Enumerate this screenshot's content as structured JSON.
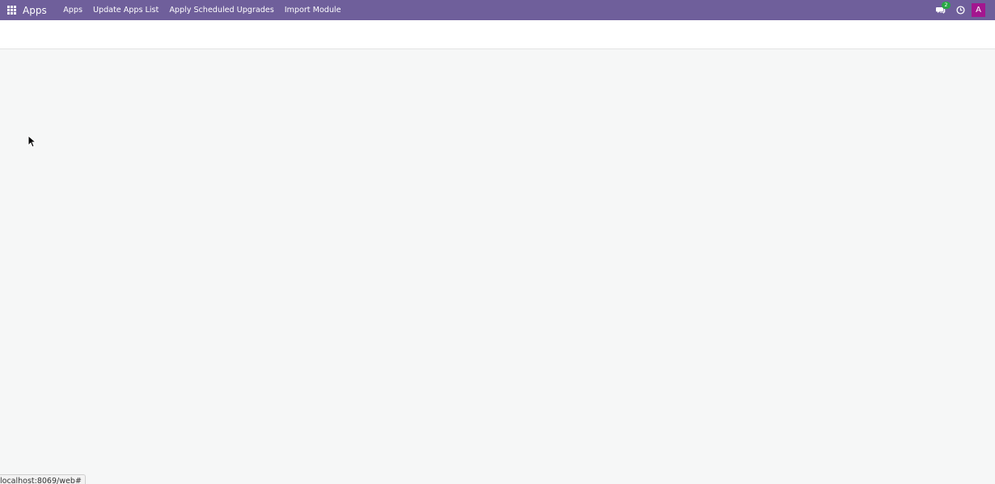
{
  "navbar": {
    "brand": "Apps",
    "menu": [
      {
        "label": "Apps"
      },
      {
        "label": "Update Apps List"
      },
      {
        "label": "Apply Scheduled Upgrades"
      },
      {
        "label": "Import Module"
      }
    ],
    "systray": {
      "messages_icon": "chat-icon",
      "messages_count": "2",
      "activity_icon": "clock-icon",
      "user_avatar_letter": "A"
    },
    "colors": {
      "navbar_bg": "#6f5f9b",
      "badge_bg": "#28a745",
      "avatar_bg": "#a3168f"
    }
  },
  "status_bar": {
    "url": "localhost:8069/web#"
  }
}
